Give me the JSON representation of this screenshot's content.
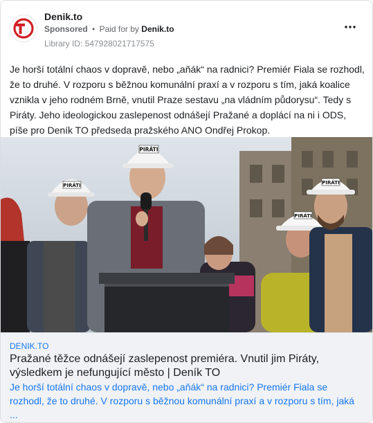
{
  "header": {
    "page_name": "Denik.to",
    "sponsored": "Sponsored",
    "separator": "•",
    "paid_for_by_prefix": "Paid for by",
    "paid_for_by": "Denik.to",
    "library_id": "Library ID: 547928021717575",
    "logo_text": "TO",
    "more_icon": "more-horizontal-icon"
  },
  "ad": {
    "text": "Je horší totální chaos v dopravě, nebo „aňák“ na radnici? Premiér Fiala se rozhodl, že to druhé. V rozporu s běžnou komunální praxí a v rozporu s tím, jaká koalice vznikla v jeho rodném Brně, vnutil Praze sestavu „na vládním půdorysu“. Tedy s Piráty. Jeho ideologickou zaslepenost odnášejí Pražané a doplácí na ni i ODS, píše pro Deník TO předseda pražského ANO Ondřej Prokop."
  },
  "image": {
    "helmet_label": "PIRÁTI"
  },
  "link": {
    "domain": "DENIK.TO",
    "title": "Pražané těžce odnášejí zaslepenost premiéra. Vnutil jim Piráty, výsledkem je nefungující město | Deník TO",
    "description": "Je horší totální chaos v dopravě, nebo „aňák“ na radnici? Premiér Fiala se rozhodl, že to druhé. V rozporu s běžnou komunální praxí a v rozporu s tím, jaká ..."
  },
  "colors": {
    "brand_red": "#d32027",
    "link_blue": "#1877f2",
    "footer_bg": "#f0f2f5"
  }
}
